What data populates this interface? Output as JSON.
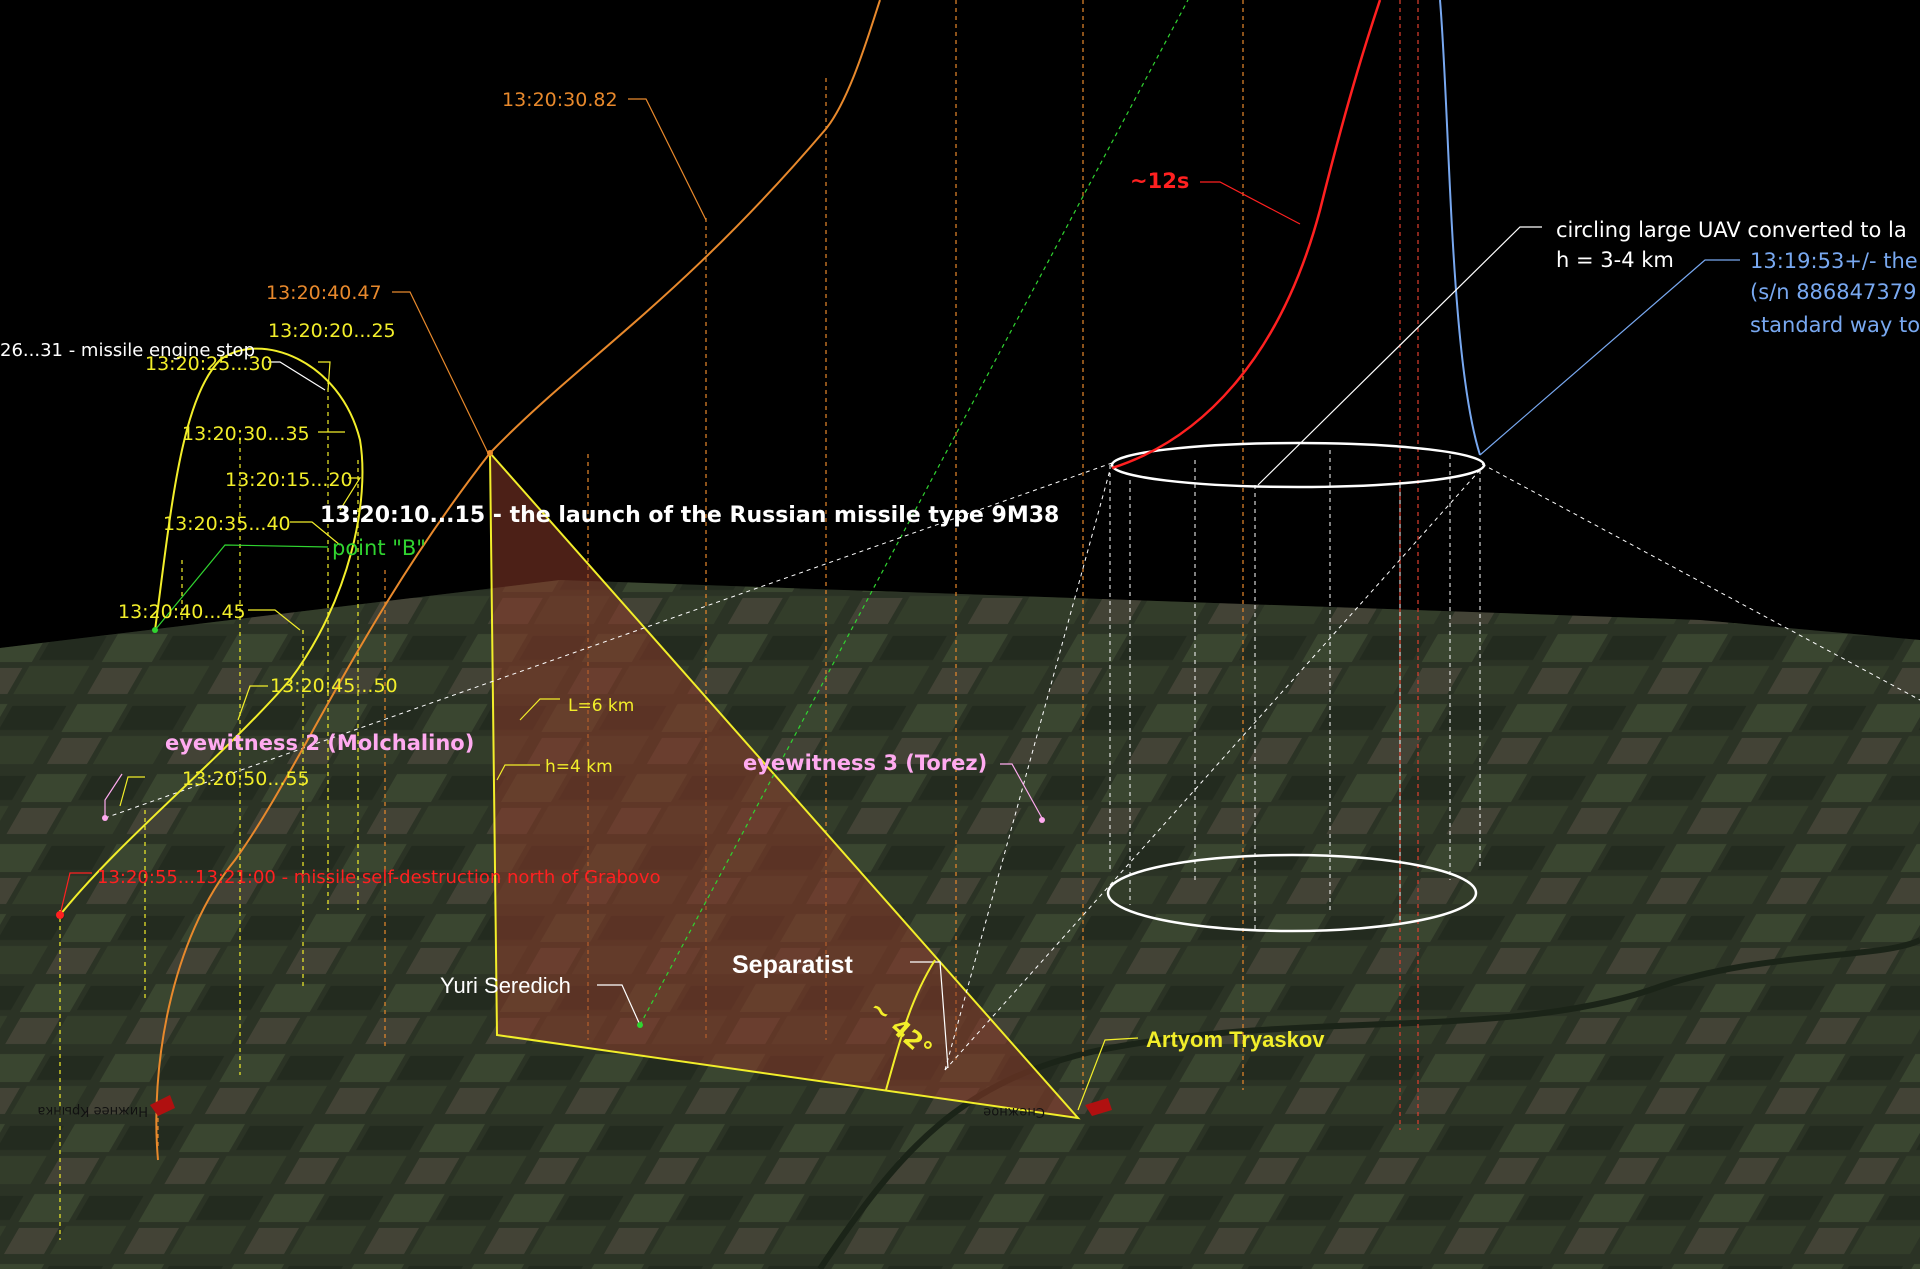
{
  "colors": {
    "sky": "#000000",
    "orange": "#e8892c",
    "yellow": "#f2ee2a",
    "red": "#ff2020",
    "blue": "#78a8f0",
    "green": "#30d430",
    "pink": "#ffaaf0",
    "white": "#ffffff",
    "ground_dark": "#2e3528",
    "ground_field": "#4a5a3c",
    "triangle_fill": "#8a3a2a"
  },
  "labels": {
    "t_30_82": "13:20:30.82",
    "t_40_47": "13:20:40.47",
    "twelve_s": "~12s",
    "uav_line1": "circling  large UAV converted to la",
    "uav_line2": "h = 3-4 km",
    "blue_line1": "13:19:53+/- the",
    "blue_line2": "(s/n 886847379",
    "blue_line3": "standard way to",
    "t_20_25": "13:20:20...25",
    "engine_stop": "26...31 - missile engine stop",
    "t_25_30": "13:20:25...30",
    "t_30_35": "13:20:30...35",
    "t_15_20": "13:20:15...20",
    "launch": "13:20:10...15 - the launch of the Russian missile type 9M38",
    "t_35_40": "13:20:35...40",
    "point_b": "point \"B\"",
    "t_40_45": "13:20:40...45",
    "t_45_50": "13:20:45...50",
    "l_6km": "L=6 km",
    "eyewitness2": "eyewitness 2 (Molchalino)",
    "h_4km": "h=4 km",
    "eyewitness3": "eyewitness 3 (Torez)",
    "t_50_55": "13:20:50...55",
    "self_destruct": "13:20:55...13:21:00 - missile self-destruction north of Grabovo",
    "separatist": "Separatist",
    "yuri": "Yuri Seredich",
    "angle": "~ 42°",
    "artyom": "Artyom Tryaskov",
    "map_town_left": "Нижнее Крынка",
    "map_town_right": "Снежное"
  }
}
